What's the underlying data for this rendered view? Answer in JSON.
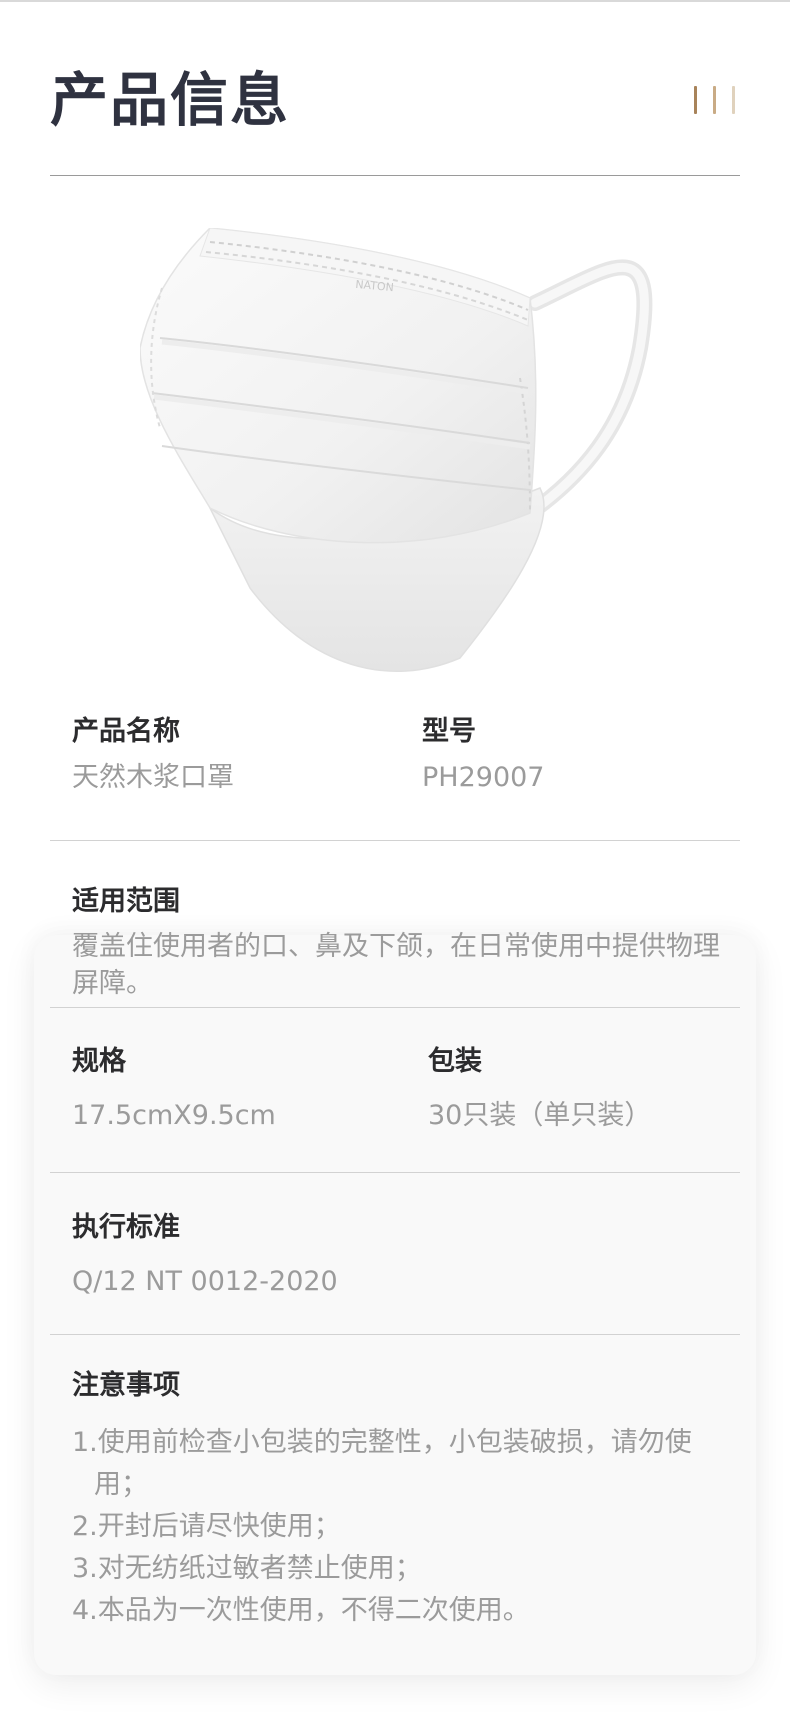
{
  "header": {
    "title": "产品信息"
  },
  "colors": {
    "deco_bar_1": "#a8835a",
    "deco_bar_2": "#c9ab85",
    "deco_bar_3": "#e0d2bd"
  },
  "image": {
    "mask_brand": "NATON"
  },
  "fields": {
    "product_name_label": "产品名称",
    "product_name_value": "天然木浆口罩",
    "model_label": "型号",
    "model_value": "PH29007",
    "scope_label": "适用范围",
    "scope_value": "覆盖住使用者的口、鼻及下颌，在日常使用中提供物理屏障。",
    "spec_label": "规格",
    "spec_value": "17.5cmX9.5cm",
    "package_label": "包装",
    "package_value": "30只装（单只装）",
    "standard_label": "执行标准",
    "standard_value": "Q/12 NT 0012-2020",
    "notes_label": "注意事项",
    "notes": [
      "1.使用前检查小包装的完整性，小包装破损，请勿使用；",
      "2.开封后请尽快使用；",
      "3.对无纺纸过敏者禁止使用；",
      "4.本品为一次性使用，不得二次使用。"
    ]
  }
}
